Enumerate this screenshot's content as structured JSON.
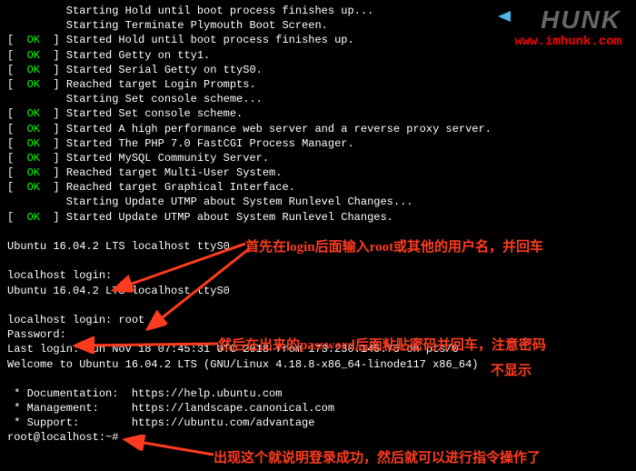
{
  "boot": [
    {
      "status": "",
      "text": "         Starting Hold until boot process finishes up..."
    },
    {
      "status": "",
      "text": "         Starting Terminate Plymouth Boot Screen."
    },
    {
      "status": "OK",
      "text": "Started Hold until boot process finishes up."
    },
    {
      "status": "OK",
      "text": "Started Getty on tty1."
    },
    {
      "status": "OK",
      "text": "Started Serial Getty on ttyS0."
    },
    {
      "status": "OK",
      "text": "Reached target Login Prompts."
    },
    {
      "status": "",
      "text": "         Starting Set console scheme..."
    },
    {
      "status": "OK",
      "text": "Started Set console scheme."
    },
    {
      "status": "OK",
      "text": "Started A high performance web server and a reverse proxy server."
    },
    {
      "status": "OK",
      "text": "Started The PHP 7.0 FastCGI Process Manager."
    },
    {
      "status": "OK",
      "text": "Started MySQL Community Server."
    },
    {
      "status": "OK",
      "text": "Reached target Multi-User System."
    },
    {
      "status": "OK",
      "text": "Reached target Graphical Interface."
    },
    {
      "status": "",
      "text": "         Starting Update UTMP about System Runlevel Changes..."
    },
    {
      "status": "OK",
      "text": "Started Update UTMP about System Runlevel Changes."
    }
  ],
  "banner1": "Ubuntu 16.04.2 LTS localhost ttyS0",
  "login_prompt1": "localhost login:",
  "banner2": "Ubuntu 16.04.2 LTS localhost ttyS0",
  "login_prompt2": "localhost login: ",
  "login_user": "root",
  "password_prompt": "Password:",
  "last_login": "Last login: Sun Nov 18 07:45:31 UTC 2018 from 173.230.145.75 on pts/0",
  "welcome": "Welcome to Ubuntu 16.04.2 LTS (GNU/Linux 4.18.8-x86_64-linode117 x86_64)",
  "links": [
    {
      "label": " * Documentation:  ",
      "url": "https://help.ubuntu.com"
    },
    {
      "label": " * Management:     ",
      "url": "https://landscape.canonical.com"
    },
    {
      "label": " * Support:        ",
      "url": "https://ubuntu.com/advantage"
    }
  ],
  "shell_prompt": "root@localhost:~#",
  "logo": {
    "brand": "HUNK",
    "url": "www.imhunk.com"
  },
  "anno": {
    "a1": "首先在login后面输入root或其他的用户名，并回车",
    "a2a": "然后在出来的password后面粘贴密码并回车，注意密码",
    "a2b": "不显示",
    "a3": "出现这个就说明登录成功，然后就可以进行指令操作了"
  }
}
